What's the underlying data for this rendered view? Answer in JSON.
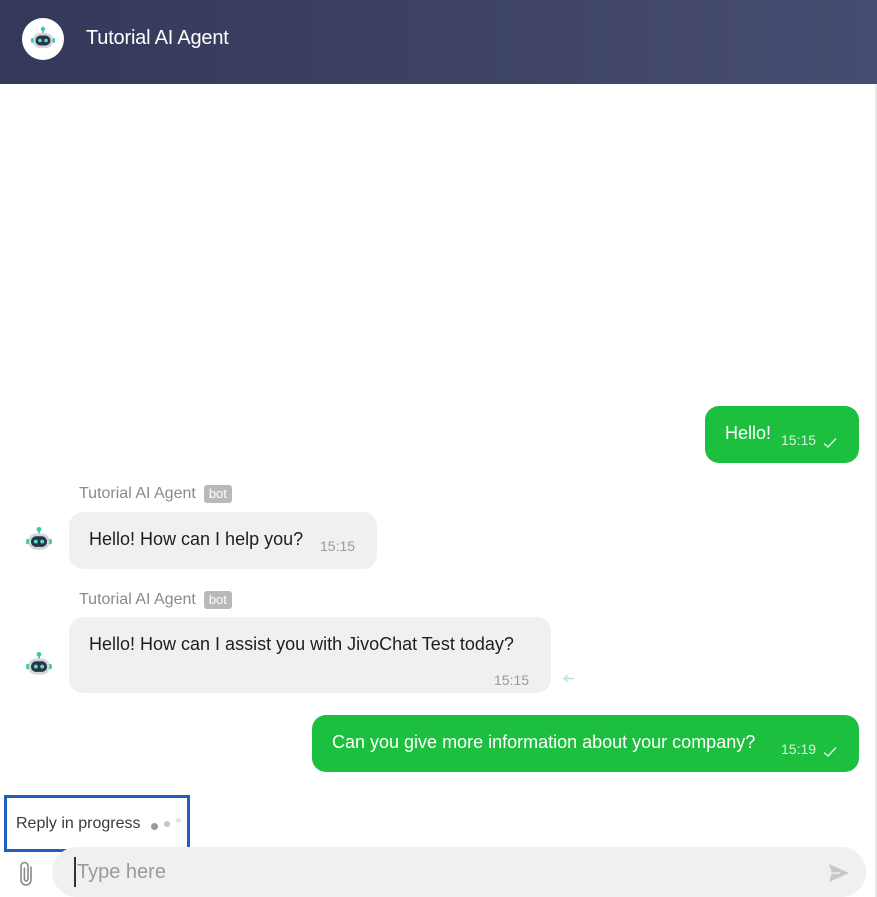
{
  "header": {
    "title": "Tutorial AI Agent",
    "avatar_icon": "robot-avatar-icon"
  },
  "messages": [
    {
      "direction": "outgoing",
      "text": "Hello!",
      "time": "15:15",
      "status_icon": "check-icon"
    },
    {
      "direction": "incoming",
      "sender": "Tutorial AI Agent",
      "badge": "bot",
      "text": "Hello! How can I help you?",
      "time": "15:15"
    },
    {
      "direction": "incoming",
      "sender": "Tutorial AI Agent",
      "badge": "bot",
      "text": "Hello! How can I assist you with JivoChat Test today?",
      "time": "15:15",
      "extra_icon": "reply-icon"
    },
    {
      "direction": "outgoing",
      "text": "Can you give more information about your company?",
      "time": "15:19",
      "status_icon": "check-icon"
    }
  ],
  "typing": {
    "text": "Reply in progress"
  },
  "composer": {
    "placeholder": "Type here",
    "value": "",
    "attach_icon": "paperclip-icon",
    "send_icon": "send-icon"
  },
  "colors": {
    "header": "#3a3f62",
    "outgoing_bubble": "#1dbf3f",
    "incoming_bubble": "#f0f0f0",
    "highlight_border": "#1f5fbf"
  }
}
